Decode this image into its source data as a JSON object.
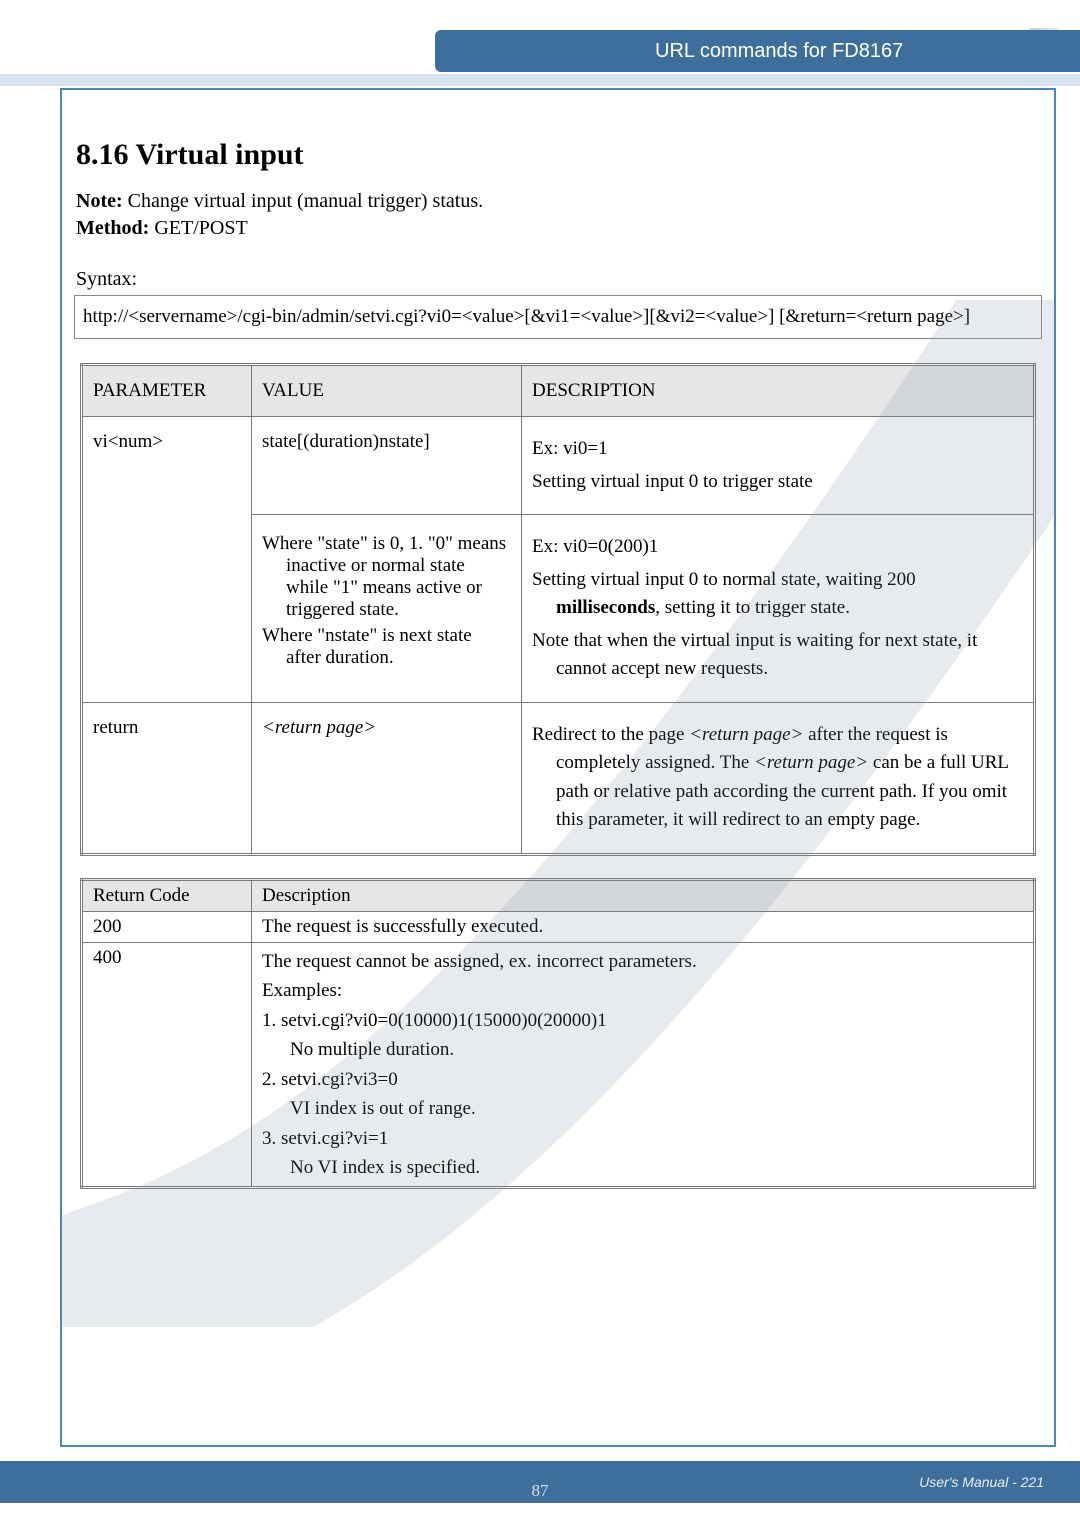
{
  "header": {
    "title": "URL commands for FD8167"
  },
  "section": {
    "heading": "8.16 Virtual input",
    "note_label": "Note:",
    "note_text": " Change virtual input (manual trigger) status.",
    "method_label": "Method:",
    "method_text": " GET/POST",
    "syntax_label": "Syntax:",
    "syntax_text": "http://<servername>/cgi-bin/admin/setvi.cgi?vi0=<value>[&vi1=<value>][&vi2=<value>] [&return=<return page>]"
  },
  "param_table": {
    "headers": {
      "c1": "PARAMETER",
      "c2": "VALUE",
      "c3": "DESCRIPTION"
    },
    "row1": {
      "param": "vi<num>",
      "value_top": "state[(duration)nstate]",
      "desc_top_l1": "Ex: vi0=1",
      "desc_top_l2": "Setting virtual input 0 to trigger state",
      "value_sub_l1": "Where \"state\" is 0, 1. \"0\" means inactive or normal state while \"1\" means active or triggered state.",
      "value_sub_l2": "Where \"nstate\" is next state after duration.",
      "desc_sub_l1": "Ex: vi0=0(200)1",
      "desc_sub_l2a": "Setting virtual input 0 to normal state, waiting 200 ",
      "desc_sub_l2b": "milliseconds",
      "desc_sub_l2c": ", setting it to trigger state.",
      "desc_sub_l3": "Note that when the virtual input is waiting for next state, it cannot accept new requests."
    },
    "row2": {
      "param": "return",
      "value": "<return page>",
      "desc_a": "Redirect to the page ",
      "desc_b": "<return page>",
      "desc_c": " after the request is completely assigned. The ",
      "desc_d": "<return page>",
      "desc_e": " can be a full URL path or relative path according the current path. If you omit this parameter, it will redirect to an empty page."
    }
  },
  "return_table": {
    "headers": {
      "c1": "Return Code",
      "c2": "Description"
    },
    "r200": {
      "code": "200",
      "desc": "The request is successfully executed."
    },
    "r400": {
      "code": "400",
      "l1": "The request cannot be assigned, ex. incorrect parameters.",
      "l2": "Examples:",
      "l3": "1. setvi.cgi?vi0=0(10000)1(15000)0(20000)1",
      "l4": "No multiple duration.",
      "l5": "2. setvi.cgi?vi3=0",
      "l6": "VI index is out of range.",
      "l7": "3. setvi.cgi?vi=1",
      "l8": "No VI index is specified."
    }
  },
  "footer": {
    "center_page": "87",
    "right_text": "User's Manual - 221"
  },
  "chart_data": {
    "type": "table",
    "tables": [
      {
        "name": "parameters",
        "columns": [
          "PARAMETER",
          "VALUE",
          "DESCRIPTION"
        ],
        "rows": [
          [
            "vi<num>",
            "state[(duration)nstate]",
            "Ex: vi0=1 — Setting virtual input 0 to trigger state"
          ],
          [
            "vi<num>",
            "Where \"state\" is 0, 1. \"0\" means inactive or normal state while \"1\" means active or triggered state. Where \"nstate\" is next state after duration.",
            "Ex: vi0=0(200)1 — Setting virtual input 0 to normal state, waiting 200 milliseconds, setting it to trigger state. Note that when the virtual input is waiting for next state, it cannot accept new requests."
          ],
          [
            "return",
            "<return page>",
            "Redirect to the page <return page> after the request is completely assigned. The <return page> can be a full URL path or relative path according the current path. If you omit this parameter, it will redirect to an empty page."
          ]
        ]
      },
      {
        "name": "return_codes",
        "columns": [
          "Return Code",
          "Description"
        ],
        "rows": [
          [
            "200",
            "The request is successfully executed."
          ],
          [
            "400",
            "The request cannot be assigned, ex. incorrect parameters. Examples: 1. setvi.cgi?vi0=0(10000)1(15000)0(20000)1 — No multiple duration. 2. setvi.cgi?vi3=0 — VI index is out of range. 3. setvi.cgi?vi=1 — No VI index is specified."
          ]
        ]
      }
    ]
  }
}
